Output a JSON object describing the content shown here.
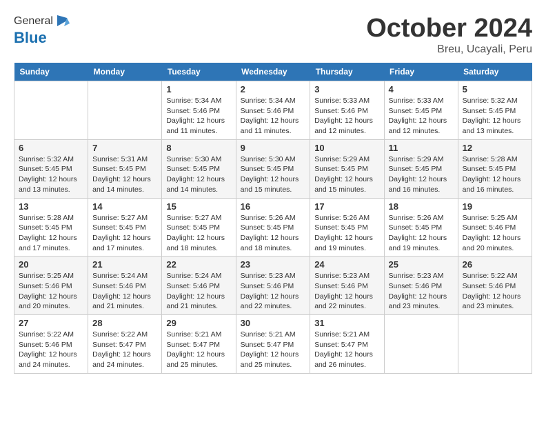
{
  "header": {
    "logo_line1": "General",
    "logo_line2": "Blue",
    "title": "October 2024",
    "location": "Breu, Ucayali, Peru"
  },
  "weekdays": [
    "Sunday",
    "Monday",
    "Tuesday",
    "Wednesday",
    "Thursday",
    "Friday",
    "Saturday"
  ],
  "weeks": [
    [
      {
        "day": "",
        "info": ""
      },
      {
        "day": "",
        "info": ""
      },
      {
        "day": "1",
        "info": "Sunrise: 5:34 AM\nSunset: 5:46 PM\nDaylight: 12 hours and 11 minutes."
      },
      {
        "day": "2",
        "info": "Sunrise: 5:34 AM\nSunset: 5:46 PM\nDaylight: 12 hours and 11 minutes."
      },
      {
        "day": "3",
        "info": "Sunrise: 5:33 AM\nSunset: 5:46 PM\nDaylight: 12 hours and 12 minutes."
      },
      {
        "day": "4",
        "info": "Sunrise: 5:33 AM\nSunset: 5:45 PM\nDaylight: 12 hours and 12 minutes."
      },
      {
        "day": "5",
        "info": "Sunrise: 5:32 AM\nSunset: 5:45 PM\nDaylight: 12 hours and 13 minutes."
      }
    ],
    [
      {
        "day": "6",
        "info": "Sunrise: 5:32 AM\nSunset: 5:45 PM\nDaylight: 12 hours and 13 minutes."
      },
      {
        "day": "7",
        "info": "Sunrise: 5:31 AM\nSunset: 5:45 PM\nDaylight: 12 hours and 14 minutes."
      },
      {
        "day": "8",
        "info": "Sunrise: 5:30 AM\nSunset: 5:45 PM\nDaylight: 12 hours and 14 minutes."
      },
      {
        "day": "9",
        "info": "Sunrise: 5:30 AM\nSunset: 5:45 PM\nDaylight: 12 hours and 15 minutes."
      },
      {
        "day": "10",
        "info": "Sunrise: 5:29 AM\nSunset: 5:45 PM\nDaylight: 12 hours and 15 minutes."
      },
      {
        "day": "11",
        "info": "Sunrise: 5:29 AM\nSunset: 5:45 PM\nDaylight: 12 hours and 16 minutes."
      },
      {
        "day": "12",
        "info": "Sunrise: 5:28 AM\nSunset: 5:45 PM\nDaylight: 12 hours and 16 minutes."
      }
    ],
    [
      {
        "day": "13",
        "info": "Sunrise: 5:28 AM\nSunset: 5:45 PM\nDaylight: 12 hours and 17 minutes."
      },
      {
        "day": "14",
        "info": "Sunrise: 5:27 AM\nSunset: 5:45 PM\nDaylight: 12 hours and 17 minutes."
      },
      {
        "day": "15",
        "info": "Sunrise: 5:27 AM\nSunset: 5:45 PM\nDaylight: 12 hours and 18 minutes."
      },
      {
        "day": "16",
        "info": "Sunrise: 5:26 AM\nSunset: 5:45 PM\nDaylight: 12 hours and 18 minutes."
      },
      {
        "day": "17",
        "info": "Sunrise: 5:26 AM\nSunset: 5:45 PM\nDaylight: 12 hours and 19 minutes."
      },
      {
        "day": "18",
        "info": "Sunrise: 5:26 AM\nSunset: 5:45 PM\nDaylight: 12 hours and 19 minutes."
      },
      {
        "day": "19",
        "info": "Sunrise: 5:25 AM\nSunset: 5:46 PM\nDaylight: 12 hours and 20 minutes."
      }
    ],
    [
      {
        "day": "20",
        "info": "Sunrise: 5:25 AM\nSunset: 5:46 PM\nDaylight: 12 hours and 20 minutes."
      },
      {
        "day": "21",
        "info": "Sunrise: 5:24 AM\nSunset: 5:46 PM\nDaylight: 12 hours and 21 minutes."
      },
      {
        "day": "22",
        "info": "Sunrise: 5:24 AM\nSunset: 5:46 PM\nDaylight: 12 hours and 21 minutes."
      },
      {
        "day": "23",
        "info": "Sunrise: 5:23 AM\nSunset: 5:46 PM\nDaylight: 12 hours and 22 minutes."
      },
      {
        "day": "24",
        "info": "Sunrise: 5:23 AM\nSunset: 5:46 PM\nDaylight: 12 hours and 22 minutes."
      },
      {
        "day": "25",
        "info": "Sunrise: 5:23 AM\nSunset: 5:46 PM\nDaylight: 12 hours and 23 minutes."
      },
      {
        "day": "26",
        "info": "Sunrise: 5:22 AM\nSunset: 5:46 PM\nDaylight: 12 hours and 23 minutes."
      }
    ],
    [
      {
        "day": "27",
        "info": "Sunrise: 5:22 AM\nSunset: 5:46 PM\nDaylight: 12 hours and 24 minutes."
      },
      {
        "day": "28",
        "info": "Sunrise: 5:22 AM\nSunset: 5:47 PM\nDaylight: 12 hours and 24 minutes."
      },
      {
        "day": "29",
        "info": "Sunrise: 5:21 AM\nSunset: 5:47 PM\nDaylight: 12 hours and 25 minutes."
      },
      {
        "day": "30",
        "info": "Sunrise: 5:21 AM\nSunset: 5:47 PM\nDaylight: 12 hours and 25 minutes."
      },
      {
        "day": "31",
        "info": "Sunrise: 5:21 AM\nSunset: 5:47 PM\nDaylight: 12 hours and 26 minutes."
      },
      {
        "day": "",
        "info": ""
      },
      {
        "day": "",
        "info": ""
      }
    ]
  ]
}
